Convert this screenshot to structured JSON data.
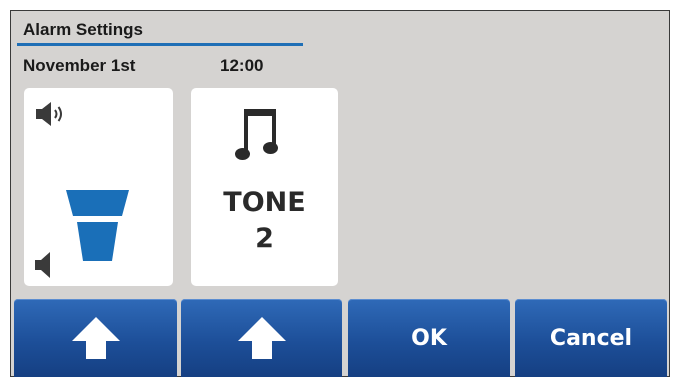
{
  "screen": {
    "title": "Alarm Settings",
    "date": "November 1st",
    "time": "12:00"
  },
  "volume": {
    "loud_icon": "speaker-loud-icon",
    "soft_icon": "speaker-soft-icon",
    "level_icon": "volume-level-bars-icon"
  },
  "tone": {
    "icon": "music-note-icon",
    "word": "TONE",
    "number": "2"
  },
  "buttons": {
    "volume_up_icon": "arrow-up-icon",
    "tone_up_icon": "arrow-up-icon",
    "ok_label": "OK",
    "cancel_label": "Cancel"
  },
  "colors": {
    "accent": "#1f6fb6",
    "button": "#1d4f99",
    "panel": "#d5d3d1"
  }
}
